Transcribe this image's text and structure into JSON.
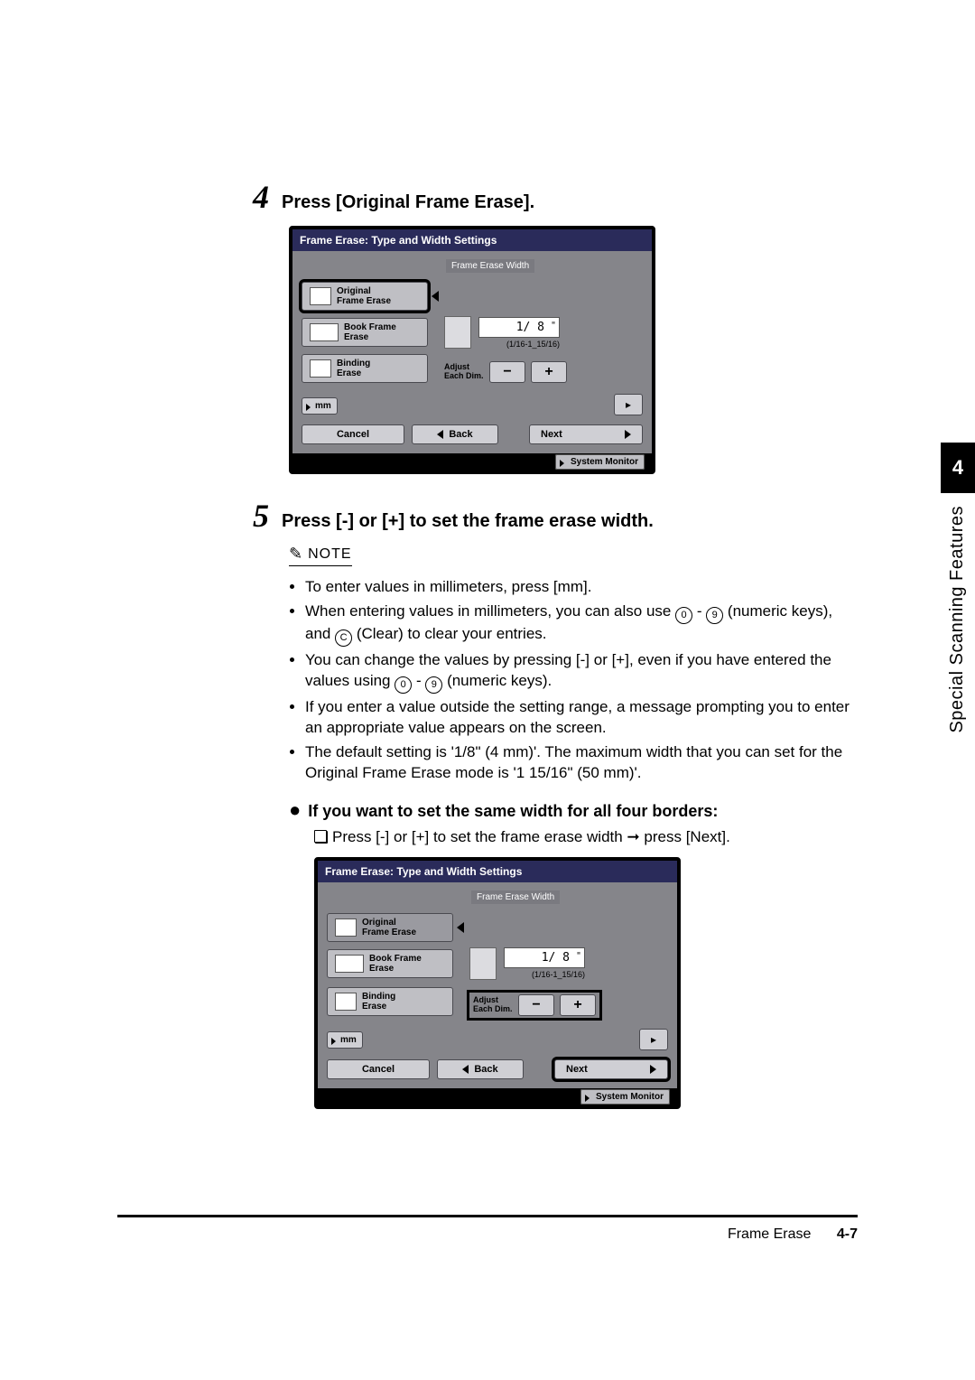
{
  "side": {
    "chapter_num": "4",
    "label": "Special Scanning Features"
  },
  "step4": {
    "num": "4",
    "title": "Press [Original Frame Erase]."
  },
  "step5": {
    "num": "5",
    "title": "Press [-] or [+] to set the frame erase width."
  },
  "panel": {
    "header": "Frame Erase: Type and Width Settings",
    "subheader": "Frame Erase Width",
    "mode_original": "Original\nFrame Erase",
    "mode_book": "Book Frame\nErase",
    "mode_binding": "Binding\nErase",
    "value": "1/ 8",
    "unit": "\"",
    "range": "(1/16-1_15/16)",
    "adjust_label": "Adjust\nEach Dim.",
    "minus": "−",
    "plus": "+",
    "mm": "mm",
    "cancel": "Cancel",
    "back": "Back",
    "next": "Next",
    "system_monitor": "System Monitor"
  },
  "note": {
    "label": "NOTE",
    "items": [
      "To enter values in millimeters, press [mm].",
      "When entering values in millimeters, you can also use ⓪ - ⑨ (numeric keys), and Ⓒ (Clear) to clear your entries.",
      "You can change the values by pressing [-] or [+], even if you have entered the values using ⓪ - ⑨ (numeric keys).",
      "If you enter a value outside the setting range, a message prompting you to enter an appropriate value appears on the screen.",
      "The default setting is '1/8\" (4 mm)'. The maximum width that you can set for the Original Frame Erase mode is '1 15/16\" (50 mm)'."
    ]
  },
  "subsection": {
    "title": "If you want to set the same width for all four borders:",
    "substep": "Press [-] or [+] to set the frame erase width ➞ press [Next]."
  },
  "footer": {
    "section": "Frame Erase",
    "page": "4-7"
  }
}
